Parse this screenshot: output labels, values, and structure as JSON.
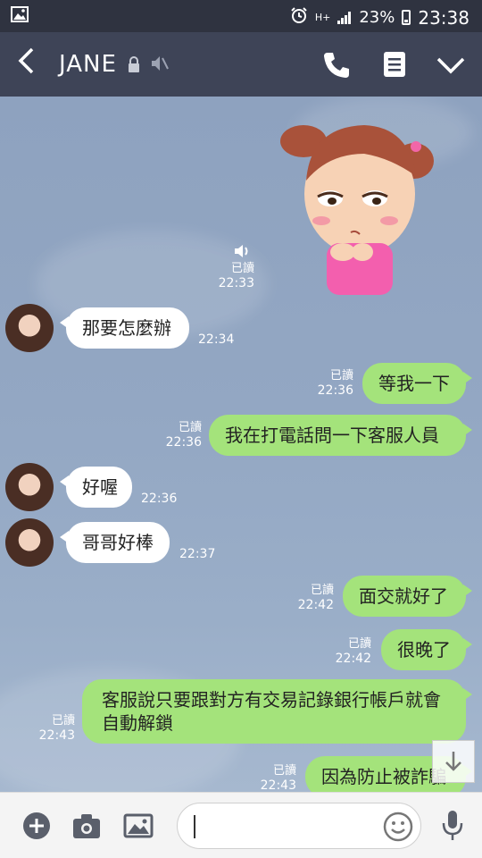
{
  "status_bar": {
    "network": "H+",
    "battery": "23%",
    "clock": "23:38"
  },
  "header": {
    "back_icon": "chevron-left-icon",
    "title": "JANE",
    "icons": [
      "lock-icon",
      "mute-icon",
      "phone-icon",
      "memo-icon",
      "chevron-down-icon"
    ]
  },
  "chat": {
    "sticker": {
      "read": "已讀",
      "time": "22:33",
      "description_icon": "girl-sticker"
    },
    "messages": [
      {
        "side": "in",
        "text": "那要怎麼辦",
        "time": "22:34"
      },
      {
        "side": "out",
        "text": "等我一下",
        "read": "已讀",
        "time": "22:36"
      },
      {
        "side": "out",
        "text": "我在打電話問一下客服人員",
        "read": "已讀",
        "time": "22:36"
      },
      {
        "side": "in",
        "text": "好喔",
        "time": "22:36"
      },
      {
        "side": "in",
        "text": "哥哥好棒",
        "time": "22:37"
      },
      {
        "side": "out",
        "text": "面交就好了",
        "read": "已讀",
        "time": "22:42"
      },
      {
        "side": "out",
        "text": "很晚了",
        "read": "已讀",
        "time": "22:42"
      },
      {
        "side": "out",
        "text": "客服說只要跟對方有交易記錄銀行帳戶就會自動解鎖",
        "read": "已讀",
        "time": "22:43"
      },
      {
        "side": "out",
        "text": "因為防止被詐騙",
        "read": "已讀",
        "time": "22:43"
      }
    ]
  },
  "input_bar": {
    "icons": [
      "plus-icon",
      "camera-icon",
      "image-icon",
      "emoji-icon",
      "microphone-icon"
    ],
    "message_value": ""
  },
  "colors": {
    "header_bg": "#3e4457",
    "status_bg": "#2f3340",
    "chat_bg": "#8fa3bf",
    "outgoing_bubble": "#a4e37b",
    "incoming_bubble": "#ffffff"
  }
}
